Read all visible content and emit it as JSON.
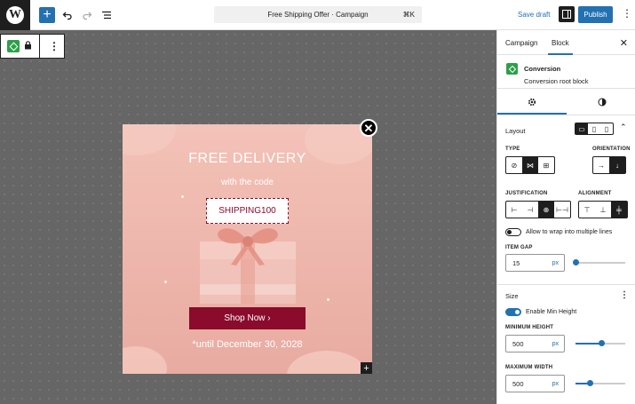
{
  "topbar": {
    "logo": "W",
    "add_icon": "plus-icon",
    "undo_icon": "undo-icon",
    "redo_icon": "redo-icon",
    "list_icon": "list-view-icon",
    "command_title": "Free Shipping Offer · Campaign",
    "command_shortcut": "⌘K",
    "save_draft": "Save draft",
    "publish": "Publish",
    "more_icon": "more-vertical-icon"
  },
  "popup": {
    "title": "FREE DELIVERY",
    "subtitle": "with the code",
    "code": "SHIPPING100",
    "shop_button": "Shop Now ›",
    "until": "*until December 30, 2028",
    "close": "✕",
    "add": "+",
    "colors": {
      "background": "#efb8ae",
      "accent": "#8a0b2c"
    }
  },
  "sidebar": {
    "tabs": [
      "Campaign",
      "Block"
    ],
    "active_tab": "Block",
    "close": "✕",
    "block_name": "Conversion",
    "block_desc": "Conversion root block",
    "layout": {
      "heading": "Layout",
      "type_label": "TYPE",
      "orientation_label": "ORIENTATION",
      "justification_label": "JUSTIFICATION",
      "alignment_label": "ALIGNMENT",
      "wrap_label": "Allow to wrap into multiple lines",
      "item_gap_label": "ITEM GAP",
      "item_gap_value": "15",
      "item_gap_unit": "px",
      "item_gap_fraction": 0.0
    },
    "size": {
      "heading": "Size",
      "enable_min_height": "Enable Min Height",
      "min_height_label": "MINIMUM HEIGHT",
      "min_height_value": "500",
      "min_height_unit": "px",
      "min_height_fraction": 0.52,
      "max_width_label": "MAXIMUM WIDTH",
      "max_width_value": "500",
      "max_width_unit": "px",
      "max_width_fraction": 0.28
    }
  }
}
